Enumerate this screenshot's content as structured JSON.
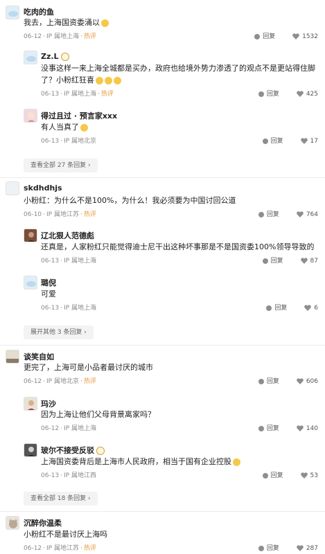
{
  "labels": {
    "reply": "回复",
    "hot": "热评",
    "sep": "·"
  },
  "comments": [
    {
      "author": "吃肉的鱼",
      "text": "我去，上海国资委涌以",
      "date": "06-12",
      "location": "IP 属地上海",
      "likes": "1532",
      "replies": [
        {
          "author": "Zz.L",
          "text_line1": "没事这样一来上海全城都是买办，政府也给境外势力渗透了的观点不是更站得住脚",
          "text_line2": "了？小粉红狂喜",
          "date": "06-13",
          "location": "IP 属地上海",
          "likes": "425"
        },
        {
          "author": "得过且过 · 预言家xxx",
          "text": "有人当真了",
          "date": "06-13",
          "location": "IP 属地北京",
          "likes": "17"
        }
      ],
      "more": "查看全部 27 条回复 ›"
    },
    {
      "author": "skdhdhjs",
      "text": "小粉红：为什么不是100%，为什么！我必须要为中国讨回公道",
      "date": "06-10",
      "location": "IP 属地江苏",
      "likes": "764",
      "replies": [
        {
          "author": "辽北狠人范德彪",
          "text": "还真是，人家粉红只能觉得迪士尼干出这种坏事那是不是国资委100%领导导致的",
          "date": "06-13",
          "location": "IP 属地上海",
          "likes": "87"
        },
        {
          "author": "璐倪",
          "text": "可爱",
          "date": "06-13",
          "location": "IP 属地上海",
          "likes": "6"
        }
      ],
      "more": "展开其他 3 条回复 ›"
    },
    {
      "author": "谈笑自如",
      "text": "更完了，上海可是小品者最讨厌的城市",
      "date": "06-12",
      "location": "IP 属地北京",
      "likes": "606",
      "replies": [
        {
          "author": "玛沙",
          "text": "因为上海让他们父母背景离家吗？",
          "date": "06-12",
          "location": "IP 属地上海",
          "likes": "140"
        },
        {
          "author": "玻尔不接受反驳",
          "text": "上海国资委背后是上海市人民政府，相当于国有企业控股",
          "date": "06-13",
          "location": "IP 属地江西",
          "likes": "53"
        }
      ],
      "more": "查看全部 18 条回复 ›"
    },
    {
      "author": "沉醉你温柔",
      "text": "小粉红不是最讨厌上海吗",
      "date": "06-12",
      "location": "IP 属地江苏",
      "likes": "287"
    }
  ]
}
